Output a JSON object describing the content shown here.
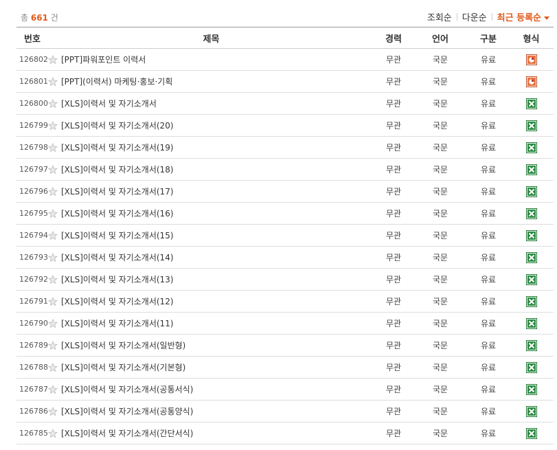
{
  "summary": {
    "prefix": "총",
    "count": "661",
    "suffix": "건"
  },
  "sort": {
    "options": [
      {
        "label": "조회순",
        "active": false
      },
      {
        "label": "다운순",
        "active": false
      },
      {
        "label": "최근 등록순",
        "active": true
      }
    ]
  },
  "columns": {
    "no": "번호",
    "title": "제목",
    "career": "경력",
    "language": "언어",
    "type": "구분",
    "format": "형식"
  },
  "rows": [
    {
      "no": "126802",
      "title": "[PPT]파워포인트 이력서",
      "career": "무관",
      "language": "국문",
      "type": "유료",
      "format": "ppt"
    },
    {
      "no": "126801",
      "title": "[PPT](이력서) 마케팅·홍보·기획",
      "career": "무관",
      "language": "국문",
      "type": "유료",
      "format": "ppt"
    },
    {
      "no": "126800",
      "title": "[XLS]이력서 및 자기소개서",
      "career": "무관",
      "language": "국문",
      "type": "유료",
      "format": "xls"
    },
    {
      "no": "126799",
      "title": "[XLS]이력서 및 자기소개서(20)",
      "career": "무관",
      "language": "국문",
      "type": "유료",
      "format": "xls"
    },
    {
      "no": "126798",
      "title": "[XLS]이력서 및 자기소개서(19)",
      "career": "무관",
      "language": "국문",
      "type": "유료",
      "format": "xls"
    },
    {
      "no": "126797",
      "title": "[XLS]이력서 및 자기소개서(18)",
      "career": "무관",
      "language": "국문",
      "type": "유료",
      "format": "xls"
    },
    {
      "no": "126796",
      "title": "[XLS]이력서 및 자기소개서(17)",
      "career": "무관",
      "language": "국문",
      "type": "유료",
      "format": "xls"
    },
    {
      "no": "126795",
      "title": "[XLS]이력서 및 자기소개서(16)",
      "career": "무관",
      "language": "국문",
      "type": "유료",
      "format": "xls"
    },
    {
      "no": "126794",
      "title": "[XLS]이력서 및 자기소개서(15)",
      "career": "무관",
      "language": "국문",
      "type": "유료",
      "format": "xls"
    },
    {
      "no": "126793",
      "title": "[XLS]이력서 및 자기소개서(14)",
      "career": "무관",
      "language": "국문",
      "type": "유료",
      "format": "xls"
    },
    {
      "no": "126792",
      "title": "[XLS]이력서 및 자기소개서(13)",
      "career": "무관",
      "language": "국문",
      "type": "유료",
      "format": "xls"
    },
    {
      "no": "126791",
      "title": "[XLS]이력서 및 자기소개서(12)",
      "career": "무관",
      "language": "국문",
      "type": "유료",
      "format": "xls"
    },
    {
      "no": "126790",
      "title": "[XLS]이력서 및 자기소개서(11)",
      "career": "무관",
      "language": "국문",
      "type": "유료",
      "format": "xls"
    },
    {
      "no": "126789",
      "title": "[XLS]이력서 및 자기소개서(일반형)",
      "career": "무관",
      "language": "국문",
      "type": "유료",
      "format": "xls"
    },
    {
      "no": "126788",
      "title": "[XLS]이력서 및 자기소개서(기본형)",
      "career": "무관",
      "language": "국문",
      "type": "유료",
      "format": "xls"
    },
    {
      "no": "126787",
      "title": "[XLS]이력서 및 자기소개서(공통서식)",
      "career": "무관",
      "language": "국문",
      "type": "유료",
      "format": "xls"
    },
    {
      "no": "126786",
      "title": "[XLS]이력서 및 자기소개서(공통양식)",
      "career": "무관",
      "language": "국문",
      "type": "유료",
      "format": "xls"
    },
    {
      "no": "126785",
      "title": "[XLS]이력서 및 자기소개서(간단서식)",
      "career": "무관",
      "language": "국문",
      "type": "유료",
      "format": "xls"
    }
  ],
  "colors": {
    "accent": "#e05a1a",
    "xls": "#1e7b34",
    "ppt": "#d24726"
  }
}
